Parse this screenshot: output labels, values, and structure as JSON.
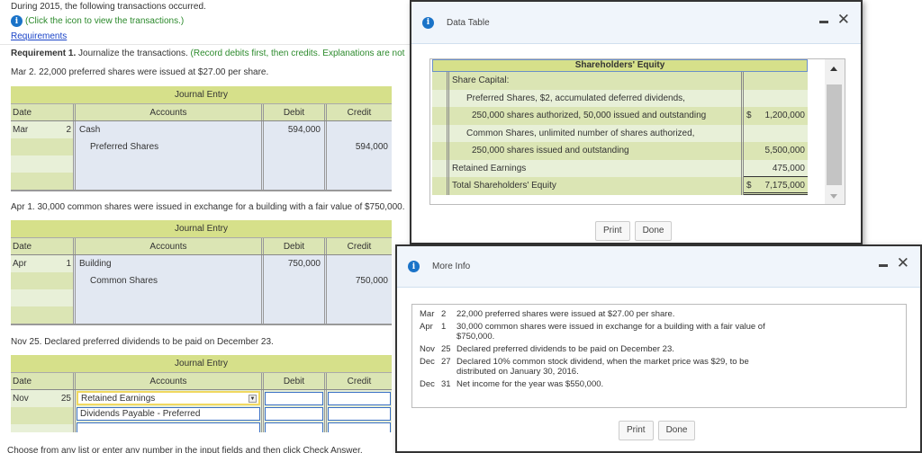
{
  "intro": "During 2015, the following transactions occurred.",
  "click_icon_text": "(Click the icon to view the transactions.)",
  "requirements_link": "Requirements",
  "requirement": {
    "label": "Requirement 1.",
    "text": " Journalize the transactions. ",
    "hint": "(Record debits first, then credits. Explanations are not"
  },
  "journal_title": "Journal Entry",
  "headers": {
    "date": "Date",
    "accounts": "Accounts",
    "debit": "Debit",
    "credit": "Credit"
  },
  "entries": [
    {
      "question": "Mar 2. 22,000 preferred shares were issued at $27.00 per share.",
      "month": "Mar",
      "day": "2",
      "rows": [
        {
          "account": "Cash",
          "debit": "594,000",
          "credit": ""
        },
        {
          "account": "Preferred Shares",
          "debit": "",
          "credit": "594,000"
        }
      ]
    },
    {
      "question": "Apr 1. 30,000 common shares were issued in exchange for a building with a fair value of $750,000.",
      "month": "Apr",
      "day": "1",
      "rows": [
        {
          "account": "Building",
          "debit": "750,000",
          "credit": ""
        },
        {
          "account": "Common Shares",
          "debit": "",
          "credit": "750,000"
        }
      ]
    },
    {
      "question": "Nov 25. Declared preferred dividends to be paid on December 23.",
      "month": "Nov",
      "day": "25",
      "rows": [
        {
          "account": "Retained Earnings",
          "debit": "",
          "credit": ""
        },
        {
          "account": "Dividends Payable - Preferred",
          "debit": "",
          "credit": ""
        },
        {
          "account": "",
          "debit": "",
          "credit": ""
        }
      ]
    }
  ],
  "footer_text": "Choose from any list or enter any number in the input fields and then click Check Answer.",
  "data_table": {
    "title": "Data Table",
    "table_title": "Shareholders' Equity",
    "rows": [
      {
        "label": "Share Capital:",
        "cur": "",
        "value": ""
      },
      {
        "label": "Preferred Shares, $2, accumulated deferred dividends,",
        "cur": "",
        "value": ""
      },
      {
        "label": "250,000 shares authorized, 50,000 issued and outstanding",
        "cur": "$",
        "value": "1,200,000"
      },
      {
        "label": "Common Shares, unlimited number of shares authorized,",
        "cur": "",
        "value": ""
      },
      {
        "label": "250,000 shares issued and outstanding",
        "cur": "",
        "value": "5,500,000"
      },
      {
        "label": "Retained Earnings",
        "cur": "",
        "value": "475,000"
      },
      {
        "label": "Total Shareholders' Equity",
        "cur": "$",
        "value": "7,175,000"
      }
    ],
    "print": "Print",
    "done": "Done"
  },
  "more_info": {
    "title": "More Info",
    "items": [
      {
        "month": "Mar",
        "day": "2",
        "text": "22,000 preferred shares were issued at $27.00 per share."
      },
      {
        "month": "Apr",
        "day": "1",
        "text": "30,000 common shares were issued in exchange for a building with a fair value of $750,000."
      },
      {
        "month": "Nov",
        "day": "25",
        "text": "Declared preferred dividends to be paid on December 23."
      },
      {
        "month": "Dec",
        "day": "27",
        "text": "Declared 10% common stock dividend, when the market price was $29, to be distributed on January 30, 2016."
      },
      {
        "month": "Dec",
        "day": "31",
        "text": "Net income for the year was $550,000."
      }
    ],
    "print": "Print",
    "done": "Done"
  }
}
